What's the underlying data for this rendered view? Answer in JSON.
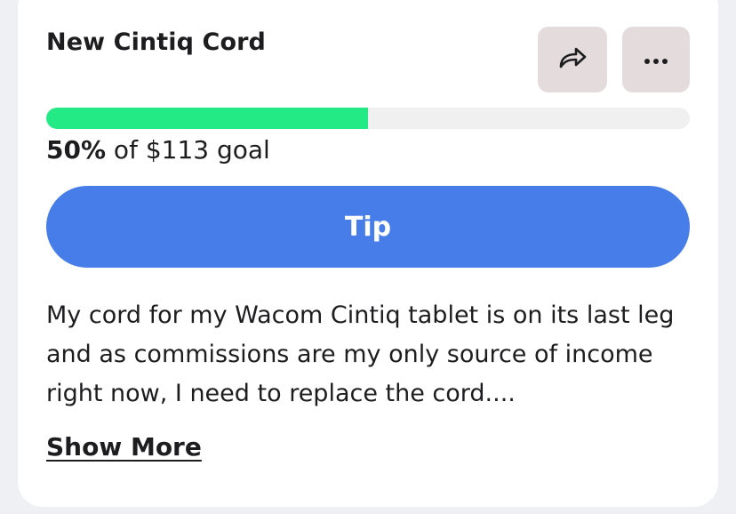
{
  "card": {
    "title": "New Cintiq Cord",
    "actions": {
      "share_icon": "share-arrow-icon",
      "more_icon": "more-dots-icon"
    },
    "progress": {
      "fraction": 0.5,
      "percent_label": "50%",
      "goal_suffix": " of $113 goal",
      "fill_color": "#23ea85"
    },
    "tip_button_label": "Tip",
    "description": "My cord for my Wacom Cintiq tablet is on its last leg and as commissions are my only source of income right now, I need to replace the cord....",
    "show_more_label": "Show More"
  },
  "colors": {
    "accent": "#477de8",
    "progress": "#23ea85",
    "icon_button_bg": "#e4dcdc"
  }
}
